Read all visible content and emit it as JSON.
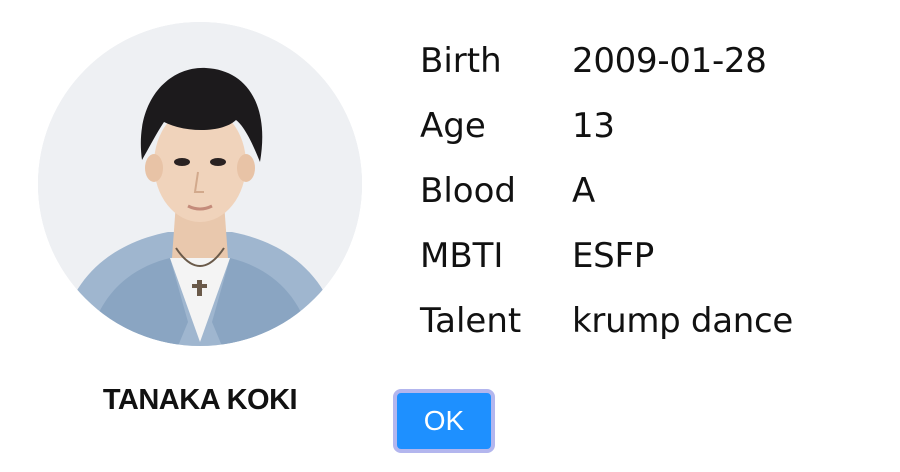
{
  "profile": {
    "name": "TANAKA KOKI",
    "fields": [
      {
        "label": "Birth",
        "value": "2009-01-28"
      },
      {
        "label": "Age",
        "value": "13"
      },
      {
        "label": "Blood",
        "value": "A"
      },
      {
        "label": "MBTI",
        "value": "ESFP"
      },
      {
        "label": "Talent",
        "value": "krump dance"
      }
    ]
  },
  "buttons": {
    "ok_label": "OK"
  },
  "colors": {
    "button_fill": "#1e90ff",
    "button_border": "#b3b6ee",
    "text": "#111111"
  }
}
